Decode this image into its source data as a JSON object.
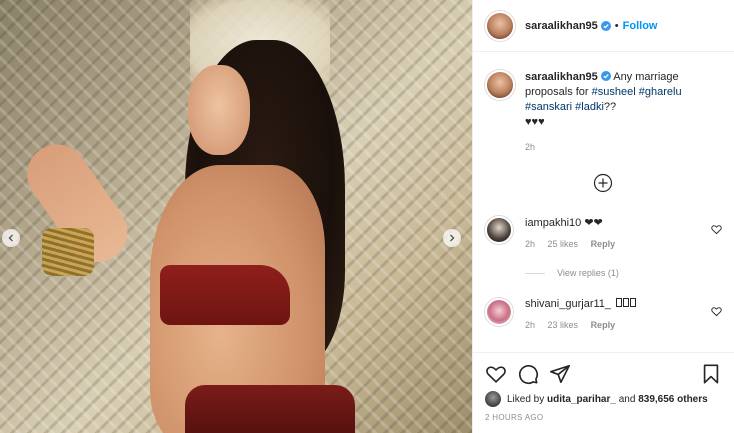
{
  "post": {
    "username": "saraalikhan95",
    "follow_label": "Follow",
    "dot": "•",
    "caption": {
      "username": "saraalikhan95",
      "text_before": " Any marriage proposals for ",
      "hashtag1": "#susheel",
      "hashtag2": "#gharelu",
      "hashtag3": "#sanskari",
      "hashtag4": "#ladki",
      "text_after": "??",
      "emoji_line": "♥♥♥",
      "time": "2h"
    },
    "comments": [
      {
        "username": "iampakhi10",
        "text": " ❤❤",
        "time": "2h",
        "likes": "25 likes",
        "reply_label": "Reply",
        "view_replies": "View replies (1)"
      },
      {
        "username": "shivani_gurjar11_",
        "text": " ",
        "time": "2h",
        "likes": "23 likes",
        "reply_label": "Reply"
      }
    ],
    "likes": {
      "prefix": "Liked by ",
      "liker": "udita_parihar_",
      "middle": " and ",
      "count": "839,656 others"
    },
    "posted": "2 HOURS AGO"
  },
  "icons": {
    "verified": "verified-badge-icon",
    "heart": "heart-icon",
    "comment": "comment-icon",
    "share": "share-icon",
    "bookmark": "bookmark-icon",
    "plus": "plus-circle-icon",
    "prev": "chevron-left-icon",
    "next": "chevron-right-icon"
  },
  "colors": {
    "accent": "#0095f6",
    "hashtag": "#00376b",
    "muted": "#8e8e8e"
  }
}
